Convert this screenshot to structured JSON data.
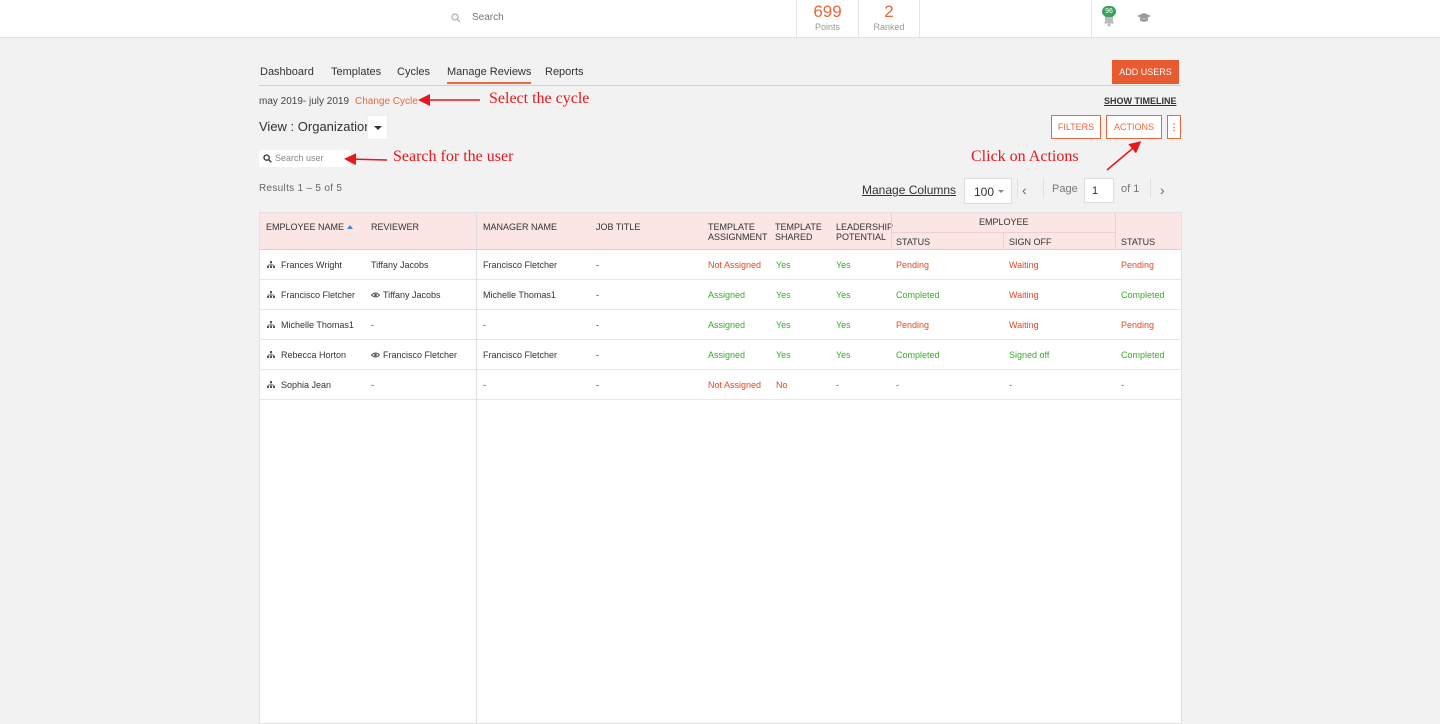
{
  "header": {
    "search_label": "Search",
    "points_value": "699",
    "points_label": "Points",
    "ranked_value": "2",
    "ranked_label": "Ranked",
    "notification_count": "96"
  },
  "nav": {
    "tabs": [
      "Dashboard",
      "Templates",
      "Cycles",
      "Manage Reviews",
      "Reports"
    ],
    "active_tab": "Manage Reviews",
    "add_users_label": "ADD USERS"
  },
  "cycle": {
    "range": "may 2019- july 2019",
    "change_label": "Change Cycle",
    "show_timeline_label": "SHOW TIMELINE"
  },
  "view": {
    "label": "View : Organization"
  },
  "toolbar": {
    "filters_label": "FILTERS",
    "actions_label": "ACTIONS",
    "more_label": "⋮",
    "search_placeholder": "Search user"
  },
  "pagination": {
    "results": "Results 1 – 5 of 5",
    "manage_columns": "Manage Columns",
    "per_page": "100",
    "page_label": "Page",
    "page_value": "1",
    "of_label": "of 1"
  },
  "annotations": {
    "select_cycle": "Select the cycle",
    "search_user": "Search for the user",
    "click_actions": "Click on Actions"
  },
  "table": {
    "headers": {
      "employee_name": "EMPLOYEE NAME",
      "reviewer": "REVIEWER",
      "manager_name": "MANAGER NAME",
      "job_title": "JOB TITLE",
      "template_assignment_1": "TEMPLATE",
      "template_assignment_2": "ASSIGNMENT",
      "template_shared_1": "TEMPLATE",
      "template_shared_2": "SHARED",
      "leadership_1": "LEADERSHIP",
      "leadership_2": "POTENTIAL",
      "employee_group": "EMPLOYEE",
      "emp_status": "STATUS",
      "sign_off": "SIGN OFF",
      "status": "STATUS"
    },
    "rows": [
      {
        "employee": "Frances Wright",
        "reviewer": "Tiffany Jacobs",
        "reviewer_eye": false,
        "manager": "Francisco Fletcher",
        "job_title": "-",
        "template_assignment": "Not Assigned",
        "template_shared": "Yes",
        "leadership": "Yes",
        "emp_status": "Pending",
        "sign_off": "Waiting",
        "status": "Pending"
      },
      {
        "employee": "Francisco Fletcher",
        "reviewer": "Tiffany Jacobs",
        "reviewer_eye": true,
        "manager": "Michelle Thomas1",
        "job_title": "-",
        "template_assignment": "Assigned",
        "template_shared": "Yes",
        "leadership": "Yes",
        "emp_status": "Completed",
        "sign_off": "Waiting",
        "status": "Completed"
      },
      {
        "employee": "Michelle Thomas1",
        "reviewer": "-",
        "reviewer_eye": false,
        "manager": "-",
        "job_title": "-",
        "template_assignment": "Assigned",
        "template_shared": "Yes",
        "leadership": "Yes",
        "emp_status": "Pending",
        "sign_off": "Waiting",
        "status": "Pending"
      },
      {
        "employee": "Rebecca Horton",
        "reviewer": "Francisco Fletcher",
        "reviewer_eye": true,
        "manager": "Francisco Fletcher",
        "job_title": "-",
        "template_assignment": "Assigned",
        "template_shared": "Yes",
        "leadership": "Yes",
        "emp_status": "Completed",
        "sign_off": "Signed off",
        "status": "Completed"
      },
      {
        "employee": "Sophia Jean",
        "reviewer": "-",
        "reviewer_eye": false,
        "manager": "-",
        "job_title": "-",
        "template_assignment": "Not Assigned",
        "template_shared": "No",
        "leadership": "-",
        "emp_status": "-",
        "sign_off": "-",
        "status": "-"
      }
    ]
  },
  "colors": {
    "accent": "#e8683f",
    "button_fill": "#e85a2f",
    "green": "#3aab2a",
    "orange": "#e8481f",
    "header_bg": "#fbe5e5",
    "annotation_red": "#e8171b"
  }
}
